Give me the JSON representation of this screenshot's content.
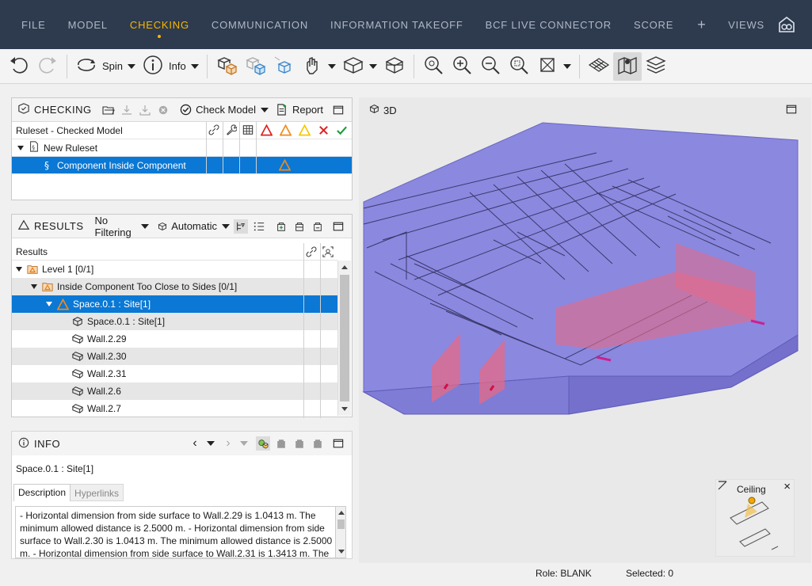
{
  "menu": {
    "items": [
      "FILE",
      "MODEL",
      "CHECKING",
      "COMMUNICATION",
      "INFORMATION TAKEOFF",
      "BCF LIVE CONNECTOR",
      "SCORE"
    ],
    "active": "CHECKING",
    "plus": "+",
    "views": "VIEWS"
  },
  "toolbar": {
    "spin_label": "Spin",
    "info_label": "Info"
  },
  "checking": {
    "title": "CHECKING",
    "check_model_label": "Check Model",
    "report_label": "Report",
    "header_label": "Ruleset - Checked Model",
    "ruleset_name": "New Ruleset",
    "rule_name": "Component Inside Component"
  },
  "results": {
    "title": "RESULTS",
    "filter_label": "No Filtering",
    "mode_label": "Automatic",
    "column_label": "Results",
    "rows": [
      {
        "label": "Level 1 [0/1]",
        "indent": 0,
        "expand": true,
        "icon": "folder-warning-icon"
      },
      {
        "label": "Inside Component Too Close to Sides [0/1]",
        "indent": 1,
        "expand": true,
        "icon": "folder-warning-icon"
      },
      {
        "label": "Space.0.1 : Site[1]",
        "indent": 2,
        "expand": true,
        "icon": "warning-triangle-icon"
      },
      {
        "label": "Space.0.1 : Site[1]",
        "indent": 3,
        "expand": false,
        "icon": "cube-icon"
      },
      {
        "label": "Wall.2.29",
        "indent": 3,
        "expand": false,
        "icon": "wall-icon"
      },
      {
        "label": "Wall.2.30",
        "indent": 3,
        "expand": false,
        "icon": "wall-icon"
      },
      {
        "label": "Wall.2.31",
        "indent": 3,
        "expand": false,
        "icon": "wall-icon"
      },
      {
        "label": "Wall.2.6",
        "indent": 3,
        "expand": false,
        "icon": "wall-icon"
      },
      {
        "label": "Wall.2.7",
        "indent": 3,
        "expand": false,
        "icon": "wall-icon"
      }
    ]
  },
  "info": {
    "title": "INFO",
    "selected_item": "Space.0.1 : Site[1]",
    "tab_description": "Description",
    "tab_hyperlinks": "Hyperlinks",
    "description": "- Horizontal dimension from side surface to Wall.2.29 is 1.0413 m. The minimum allowed distance is 2.5000 m. - Horizontal dimension from side surface to Wall.2.30 is 1.0413 m. The minimum allowed distance is 2.5000 m. - Horizontal dimension from side surface to Wall.2.31 is 1.3413 m. The"
  },
  "viewport": {
    "title": "3D",
    "navcube_label": "Ceiling"
  },
  "status": {
    "role": "Role: BLANK",
    "selected": "Selected: 0"
  },
  "colors": {
    "menubar_bg": "#2e3a4d",
    "menu_active": "#f5b800",
    "selection": "#0a78d4",
    "slab": "#8b88e0",
    "wall_highlight": "#e66a86"
  }
}
